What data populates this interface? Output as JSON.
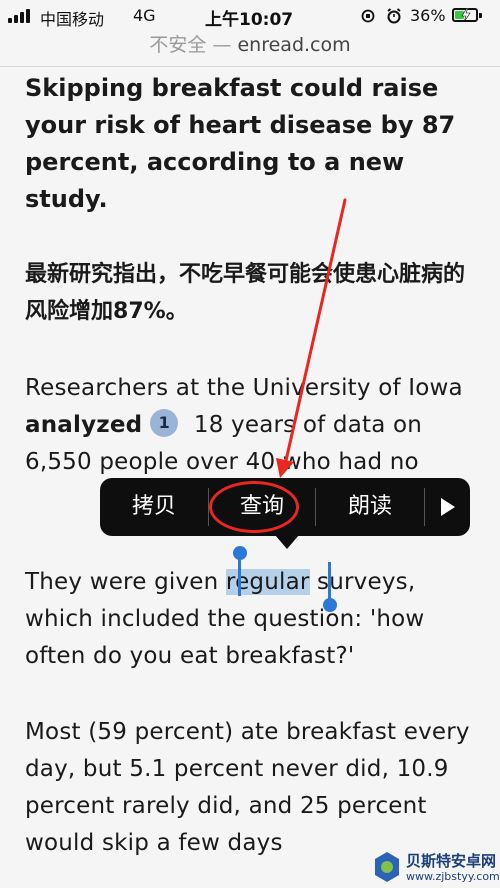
{
  "status_bar": {
    "carrier": "中国移动",
    "network": "4G",
    "time": "上午10:07",
    "battery": "36%",
    "icons": [
      "signal-icon",
      "orientation-lock-icon",
      "alarm-icon",
      "battery-charging-icon"
    ]
  },
  "url_bar": {
    "security": "不安全",
    "separator": " — ",
    "domain": "enread.com"
  },
  "article": {
    "headline": "Skipping breakfast could raise your risk of heart disease by 87 percent, according to a new study.",
    "headline_cn_prefix": "最新研究指出，不吃早餐可能会使患心脏病的风险增加",
    "headline_cn_bold": "87%",
    "headline_cn_suffix": "。",
    "p1_before": "Researchers at the University of Iowa ",
    "p1_bold": "analyzed",
    "p1_badge": "1",
    "p1_after": " 18 years of data on 6,550 people over 40 who had no",
    "p2_before": "They were given ",
    "p2_selected": "regular",
    "p2_after": " surveys, which included the question: 'how often do you eat breakfast?'",
    "p3": "Most (59 percent) ate breakfast every day, but 5.1 percent never did, 10.9 percent rarely did, and 25 percent would skip a few days"
  },
  "edit_menu": {
    "items": [
      "拷贝",
      "查询",
      "朗读"
    ],
    "more_icon": "play-right-icon",
    "highlighted_item": "查询"
  },
  "annotation": {
    "color": "#e8281e"
  },
  "watermark": {
    "title": "贝斯特安卓网",
    "url": "www.zjbstyy.com"
  }
}
